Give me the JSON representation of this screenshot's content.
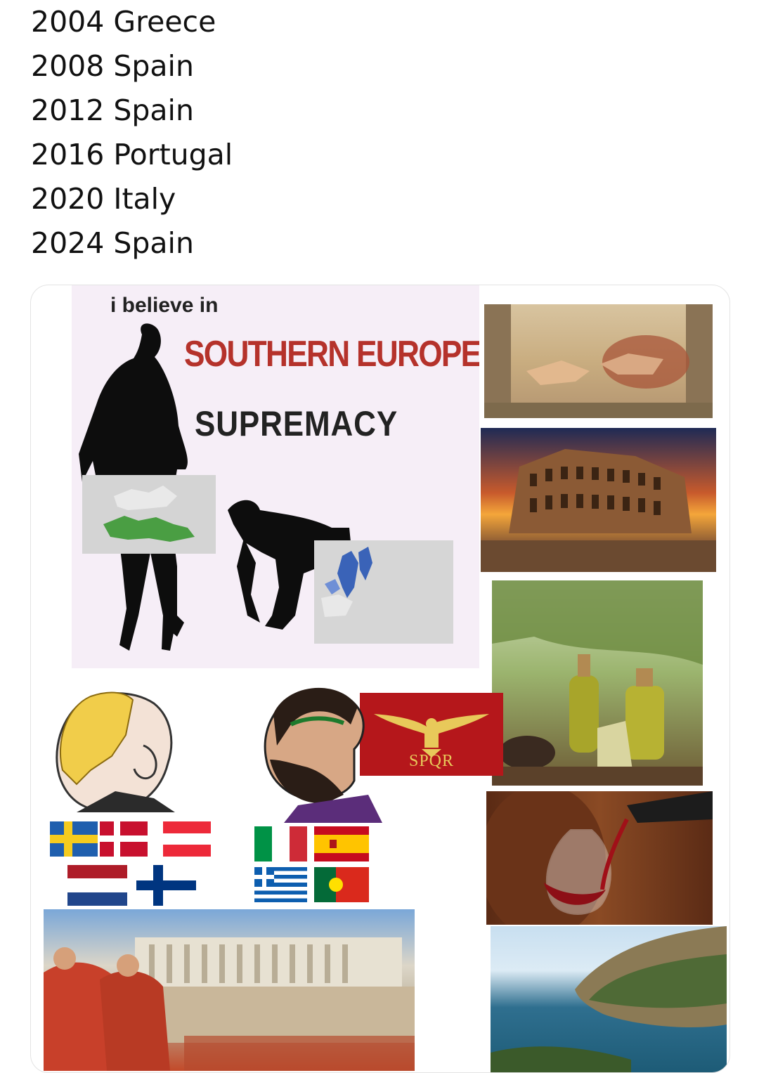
{
  "post": {
    "lines": [
      "2004 Greece",
      "2008 Spain",
      "2012 Spain",
      "2016 Portugal",
      "2020 Italy",
      "2024 Spain"
    ]
  },
  "meme": {
    "line1": "i believe in",
    "line2": "SOUTHERN EUROPE",
    "line3": "SUPREMACY",
    "spqr_text": "SPQR"
  },
  "colors": {
    "meme_bg": "#f6eef7",
    "headline_red": "#b5322b",
    "spqr_red": "#b5171b",
    "spqr_gold": "#e8c95a"
  }
}
